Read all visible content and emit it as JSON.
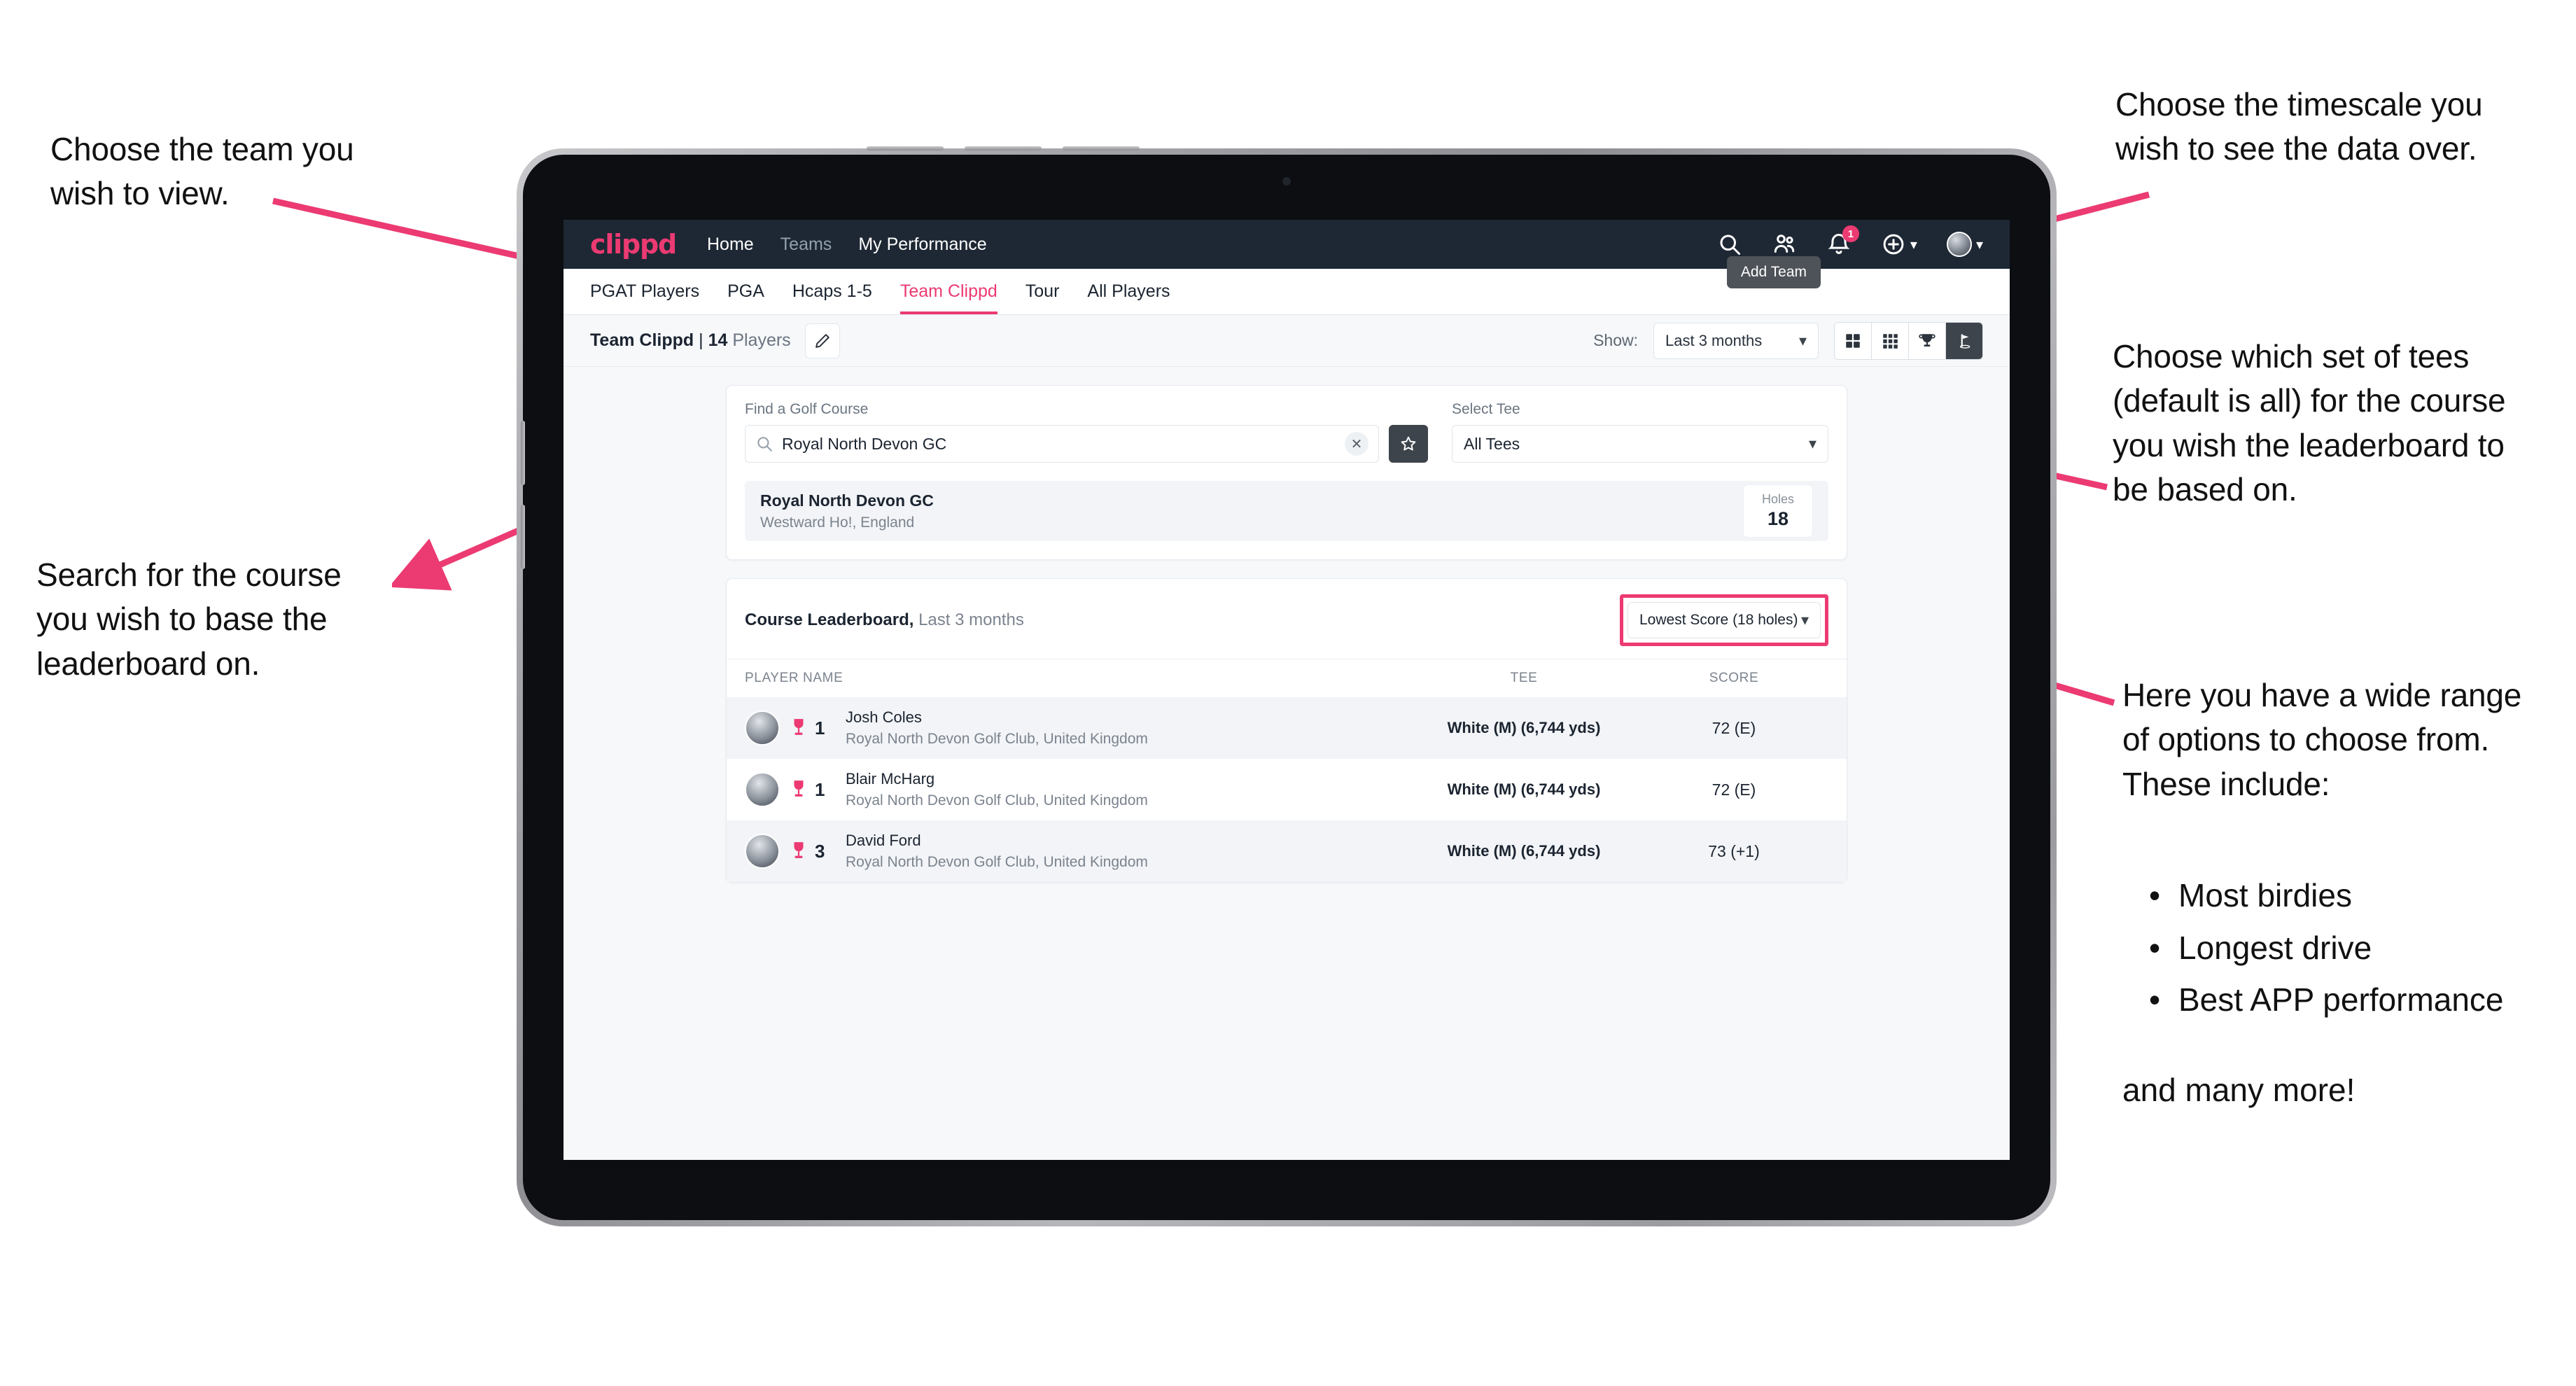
{
  "annotations": {
    "team": "Choose the team you\nwish to view.",
    "search": "Search for the course\nyou wish to base the\nleaderboard on.",
    "timescale": "Choose the timescale you\nwish to see the data over.",
    "tees": "Choose which set of tees\n(default is all) for the course\nyou wish the leaderboard to\nbe based on.",
    "options_intro": "Here you have a wide range\nof options to choose from.\nThese include:",
    "options_list": [
      "Most birdies",
      "Longest drive",
      "Best APP performance"
    ],
    "options_outro": "and many more!",
    "bullet_glyph": "•",
    "arrow_color": "#ec3a72"
  },
  "app": {
    "brand": "clippd",
    "nav_links": [
      {
        "label": "Home",
        "active": true
      },
      {
        "label": "Teams",
        "active": false
      },
      {
        "label": "My Performance",
        "active": true
      }
    ],
    "nav_icons": [
      {
        "name": "search-icon"
      },
      {
        "name": "people-icon"
      },
      {
        "name": "bell-icon",
        "badge": "1"
      },
      {
        "name": "plus-circle-icon"
      },
      {
        "name": "avatar-icon"
      }
    ],
    "tabs": [
      {
        "label": "PGAT Players",
        "state": "normal"
      },
      {
        "label": "PGA",
        "state": "normal"
      },
      {
        "label": "Hcaps 1-5",
        "state": "normal"
      },
      {
        "label": "Team Clippd",
        "state": "active"
      },
      {
        "label": "Tour",
        "state": "normal"
      },
      {
        "label": "All Players",
        "state": "normal"
      }
    ],
    "tooltip": "Add Team",
    "toolbar": {
      "team_name": "Team Clippd",
      "separator": " | ",
      "player_count": "14",
      "players_word": " Players",
      "edit_icon": "pencil-icon",
      "show_label": "Show:",
      "show_value": "Last 3 months",
      "view_modes": [
        {
          "name": "grid-large-icon",
          "active": false
        },
        {
          "name": "grid-small-icon",
          "active": false
        },
        {
          "name": "trophy-icon",
          "active": false
        },
        {
          "name": "golf-flag-icon",
          "active": true
        }
      ]
    },
    "search_panel": {
      "course_label": "Find a Golf Course",
      "course_value": "Royal North Devon GC",
      "course_placeholder": "Find a Golf Course",
      "clear_glyph": "✕",
      "favourite_icon": "star-icon",
      "tee_label": "Select Tee",
      "tee_value": "All Tees"
    },
    "course_result": {
      "name": "Royal North Devon GC",
      "location": "Westward Ho!, England",
      "holes_label": "Holes",
      "holes_value": "18"
    },
    "leaderboard": {
      "title": "Course Leaderboard,",
      "subtitle": " Last 3 months",
      "sort_value": "Lowest Score (18 holes)",
      "columns": [
        "PLAYER NAME",
        "TEE",
        "SCORE"
      ],
      "rows": [
        {
          "rank": "1",
          "name": "Josh Coles",
          "club": "Royal North Devon Golf Club, United Kingdom",
          "tee": "White (M) (6,744 yds)",
          "score": "72 (E)"
        },
        {
          "rank": "1",
          "name": "Blair McHarg",
          "club": "Royal North Devon Golf Club, United Kingdom",
          "tee": "White (M) (6,744 yds)",
          "score": "72 (E)"
        },
        {
          "rank": "3",
          "name": "David Ford",
          "club": "Royal North Devon Golf Club, United Kingdom",
          "tee": "White (M) (6,744 yds)",
          "score": "73 (+1)"
        }
      ]
    }
  },
  "colors": {
    "brand_pink": "#ec3a72",
    "navbar_dark": "#1e2834",
    "page_bg": "#f6f8fa",
    "accent_dark": "#3e444b"
  }
}
